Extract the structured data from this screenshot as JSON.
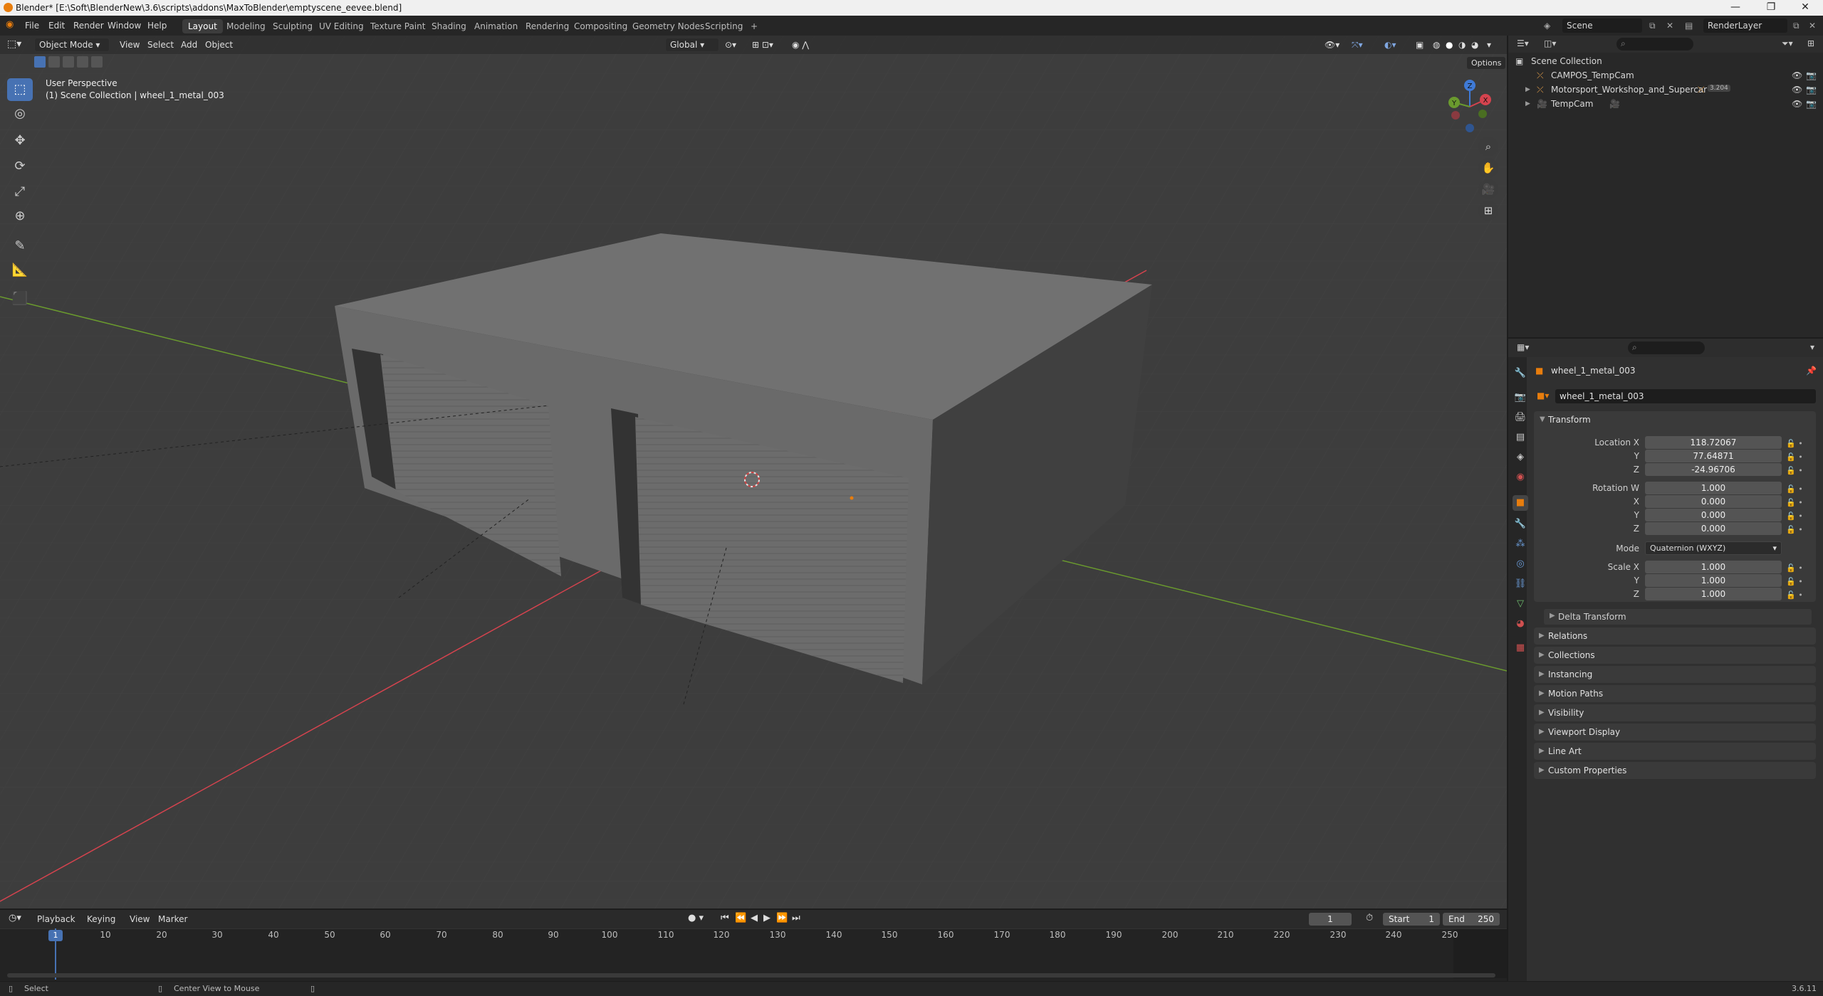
{
  "titlebar": {
    "title": "Blender* [E:\\Soft\\BlenderNew\\3.6\\scripts\\addons\\MaxToBlender\\emptyscene_eevee.blend]",
    "minimize": "—",
    "maximize": "❐",
    "close": "✕"
  },
  "menu": [
    "File",
    "Edit",
    "Render",
    "Window",
    "Help"
  ],
  "workspaces": [
    "Layout",
    "Modeling",
    "Sculpting",
    "UV Editing",
    "Texture Paint",
    "Shading",
    "Animation",
    "Rendering",
    "Compositing",
    "Geometry Nodes",
    "Scripting"
  ],
  "active_workspace": "Layout",
  "add_workspace": "+",
  "scene_name": "Scene",
  "view_layer": "RenderLayer",
  "viewport_header": {
    "mode": "Object Mode",
    "menus": [
      "View",
      "Select",
      "Add",
      "Object"
    ],
    "orientation": "Global",
    "options": "Options"
  },
  "viewport_overlay": {
    "perspective": "User Perspective",
    "collection": "(1) Scene Collection | wheel_1_metal_003"
  },
  "gizmo_axes": {
    "x": "X",
    "y": "Y",
    "z": "Z"
  },
  "outliner": {
    "root": "Scene Collection",
    "items": [
      {
        "label": "CAMPOS_TempCam"
      },
      {
        "label": "Motorsport_Workshop_and_Supercar",
        "badge": "3.204"
      },
      {
        "label": "TempCam"
      }
    ]
  },
  "properties": {
    "object_name": "wheel_1_metal_003",
    "datablock_name": "wheel_1_metal_003",
    "transform_title": "Transform",
    "location": {
      "label_x": "Location X",
      "label_y": "Y",
      "label_z": "Z",
      "x": "118.72067",
      "y": "77.64871",
      "z": "-24.96706"
    },
    "rotation": {
      "label_w": "Rotation W",
      "label_x": "X",
      "label_y": "Y",
      "label_z": "Z",
      "w": "1.000",
      "x": "0.000",
      "y": "0.000",
      "z": "0.000"
    },
    "mode": {
      "label": "Mode",
      "value": "Quaternion (WXYZ)"
    },
    "scale": {
      "label_x": "Scale X",
      "label_y": "Y",
      "label_z": "Z",
      "x": "1.000",
      "y": "1.000",
      "z": "1.000"
    },
    "delta_transform": "Delta Transform",
    "panels": [
      "Relations",
      "Collections",
      "Instancing",
      "Motion Paths",
      "Visibility",
      "Viewport Display",
      "Line Art",
      "Custom Properties"
    ]
  },
  "timeline": {
    "menus": [
      "Playback",
      "Keying",
      "View",
      "Marker"
    ],
    "current_frame": "1",
    "start_label": "Start",
    "start": "1",
    "end_label": "End",
    "end": "250",
    "ticks": [
      "1",
      "10",
      "20",
      "30",
      "40",
      "50",
      "60",
      "70",
      "80",
      "90",
      "100",
      "110",
      "120",
      "130",
      "140",
      "150",
      "160",
      "170",
      "180",
      "190",
      "200",
      "210",
      "220",
      "230",
      "240",
      "250"
    ]
  },
  "statusbar": {
    "select": "Select",
    "center": "Center View to Mouse",
    "version": "3.6.11"
  },
  "colors": {
    "accent": "#4772b3",
    "x_axis": "#d4434e",
    "y_axis": "#6a9a2e",
    "z_axis": "#3f7ad6",
    "object_orange": "#e87d0d"
  }
}
